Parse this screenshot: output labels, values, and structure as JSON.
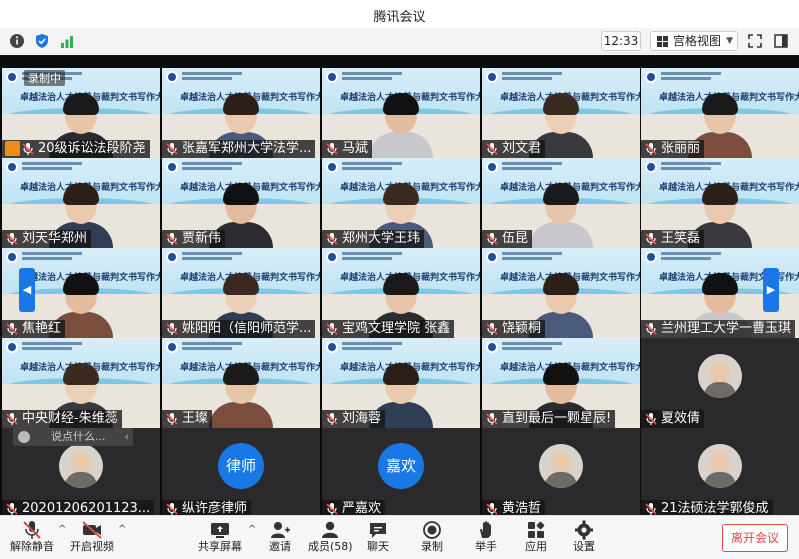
{
  "window": {
    "title": "腾讯会议"
  },
  "infobar": {
    "time": "12:33",
    "view_label": "宫格视图"
  },
  "recording": {
    "label": "录制中"
  },
  "banner_title": "卓越法治人才培养与裁判文书写作大赛",
  "tiles": [
    {
      "name": "20级诉讼法段阶尧",
      "kind": "video"
    },
    {
      "name": "张嘉军郑州大学法学...",
      "kind": "video"
    },
    {
      "name": "马斌",
      "kind": "video"
    },
    {
      "name": "刘文君",
      "kind": "video"
    },
    {
      "name": "张丽丽",
      "kind": "video"
    },
    {
      "name": "刘天华郑州",
      "kind": "video"
    },
    {
      "name": "贾新伟",
      "kind": "video"
    },
    {
      "name": "郑州大学王玮",
      "kind": "video"
    },
    {
      "name": "伍昆",
      "kind": "video"
    },
    {
      "name": "王笑磊",
      "kind": "video"
    },
    {
      "name": "焦艳红",
      "kind": "video"
    },
    {
      "name": "姚阳阳（信阳师范学...",
      "kind": "video"
    },
    {
      "name": "宝鸡文理学院 张鑫",
      "kind": "video"
    },
    {
      "name": "饶颖桐",
      "kind": "video"
    },
    {
      "name": "兰州理工大学一曹玉琪",
      "kind": "video"
    },
    {
      "name": "中央财经-朱维蕊",
      "kind": "video"
    },
    {
      "name": "王璨",
      "kind": "video"
    },
    {
      "name": "刘海蓉",
      "kind": "video"
    },
    {
      "name": "直到最后一颗星辰!",
      "kind": "video"
    },
    {
      "name": "夏效倩",
      "kind": "avatar-photo"
    },
    {
      "name": "20201206201123...",
      "kind": "avatar-photo"
    },
    {
      "name": "纵许彦律师",
      "kind": "avatar-text",
      "avatar_text": "律师"
    },
    {
      "name": "严嘉欢",
      "kind": "avatar-text",
      "avatar_text": "嘉欢"
    },
    {
      "name": "黄浩哲",
      "kind": "avatar-photo"
    },
    {
      "name": "21法硕法学郭俊成",
      "kind": "avatar-photo"
    }
  ],
  "chat": {
    "placeholder": "说点什么..."
  },
  "toolbar": {
    "unmute": "解除静音",
    "start_video": "开启视频",
    "share_screen": "共享屏幕",
    "invite": "邀请",
    "members": "成员(58)",
    "chat": "聊天",
    "record": "录制",
    "raise_hand": "举手",
    "apps": "应用",
    "settings": "设置",
    "leave": "离开会议"
  },
  "colors": {
    "accent": "#1a78e6",
    "leave": "#e04848",
    "grid_bg": "#0b0b0d"
  }
}
